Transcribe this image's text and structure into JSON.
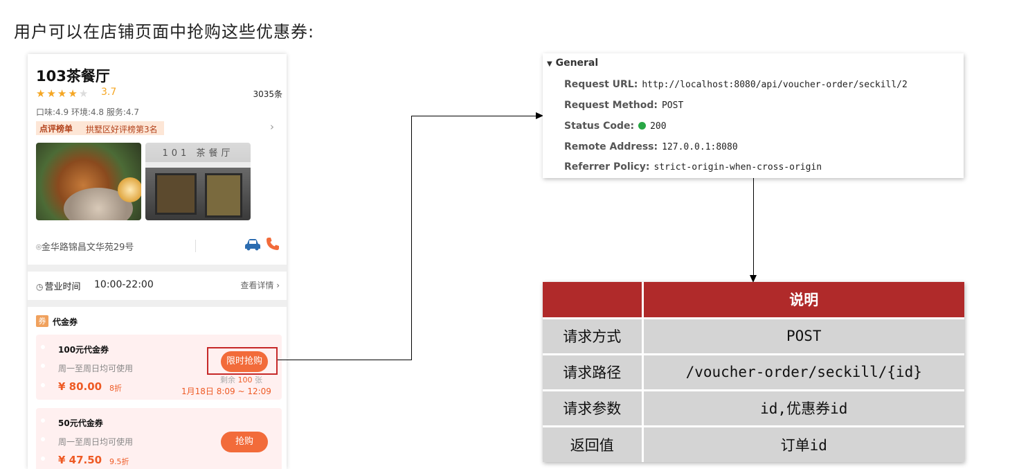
{
  "heading": "用户可以在店铺页面中抢购这些优惠券:",
  "shop": {
    "name": "103茶餐厅",
    "rating": 3.7,
    "score": "3.7",
    "review_count": "3035条",
    "subscores": "口味:4.9 环境:4.8 服务:4.7",
    "rank_tag": "点评榜单",
    "rank_text": "拱墅区好评榜第3名",
    "photo2_sign": "101 茶餐厅",
    "address": "金华路锦昌文华苑29号",
    "hours_label": "营业时间",
    "hours_value": "10:00-22:00",
    "details_link": "查看详情",
    "voucher_section_icon": "券",
    "voucher_section_title": "代金券"
  },
  "vouchers": [
    {
      "title": "100元代金券",
      "desc": "周一至周日均可使用",
      "price": "¥ 80.00",
      "discount": "8折",
      "button": "限时抢购",
      "remain_prefix": "剩余",
      "remain_count": "100",
      "remain_suffix": "张",
      "time": "1月18日 8:09 ~ 12:09"
    },
    {
      "title": "50元代金券",
      "desc": "周一至周日均可使用",
      "price": "¥ 47.50",
      "discount": "9.5折",
      "button": "抢购"
    }
  ],
  "request": {
    "section": "General",
    "rows": [
      {
        "key": "Request URL:",
        "value": "http://localhost:8080/api/voucher-order/seckill/2"
      },
      {
        "key": "Request Method:",
        "value": "POST"
      },
      {
        "key": "Status Code:",
        "value": "200"
      },
      {
        "key": "Remote Address:",
        "value": "127.0.0.1:8080"
      },
      {
        "key": "Referrer Policy:",
        "value": "strict-origin-when-cross-origin"
      }
    ],
    "status_color": "#28a745"
  },
  "table": {
    "header": [
      "",
      "说明"
    ],
    "rows": [
      [
        "请求方式",
        "POST"
      ],
      [
        "请求路径",
        "/voucher-order/seckill/{id}"
      ],
      [
        "请求参数",
        "id,优惠券id"
      ],
      [
        "返回值",
        "订单id"
      ]
    ],
    "header_color": "#b02a2a",
    "cell_color": "#d4d4d4"
  },
  "colors": {
    "accent": "#f26b3a",
    "highlight_box": "#c62828"
  },
  "icons": [
    "car-icon",
    "phone-icon",
    "location-icon",
    "clock-icon",
    "chevron-right-icon",
    "star-icon"
  ]
}
